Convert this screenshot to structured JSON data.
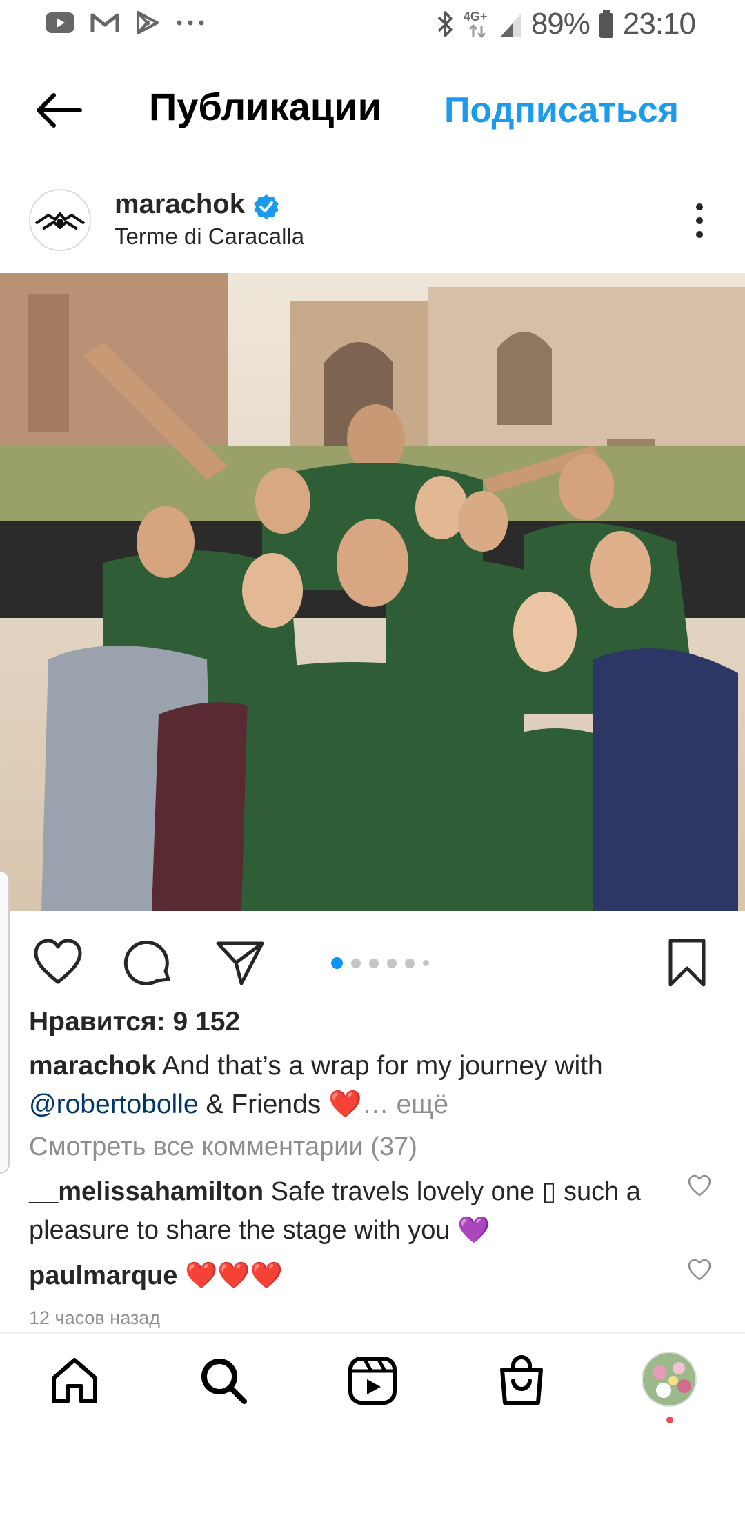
{
  "status_bar": {
    "network": "4G+",
    "battery": "89%",
    "time": "23:10",
    "icons": [
      "youtube-icon",
      "gmail-icon",
      "play-store-icon",
      "more-dots-icon",
      "bluetooth-icon",
      "signal-icon",
      "battery-icon"
    ]
  },
  "top_bar": {
    "title": "Публикации",
    "follow": "Подписаться",
    "accent": "#1a9bf0"
  },
  "post": {
    "username": "marachok",
    "location": "Terme di Caracalla",
    "verified": true,
    "carousel": {
      "count": 6,
      "active_index": 0
    }
  },
  "likes": {
    "label": "Нравится: 9 152"
  },
  "caption": {
    "username": "marachok",
    "text_before": "And that’s a wrap for my journey with",
    "mention": "@robertobolle",
    "text_after": "& Friends ❤️",
    "more": "… ещё"
  },
  "view_all_comments": "Смотреть все комментарии (37)",
  "comments": [
    {
      "username": "__melissahamilton",
      "text": "Safe travels lovely one ▯ such a pleasure to share the stage with you 💜"
    },
    {
      "username": "paulmarque",
      "text": "❤️❤️❤️"
    }
  ],
  "time_ago": "12 часов назад",
  "bottom_nav": [
    "home-icon",
    "search-icon",
    "reels-icon",
    "shop-icon",
    "profile-avatar"
  ]
}
